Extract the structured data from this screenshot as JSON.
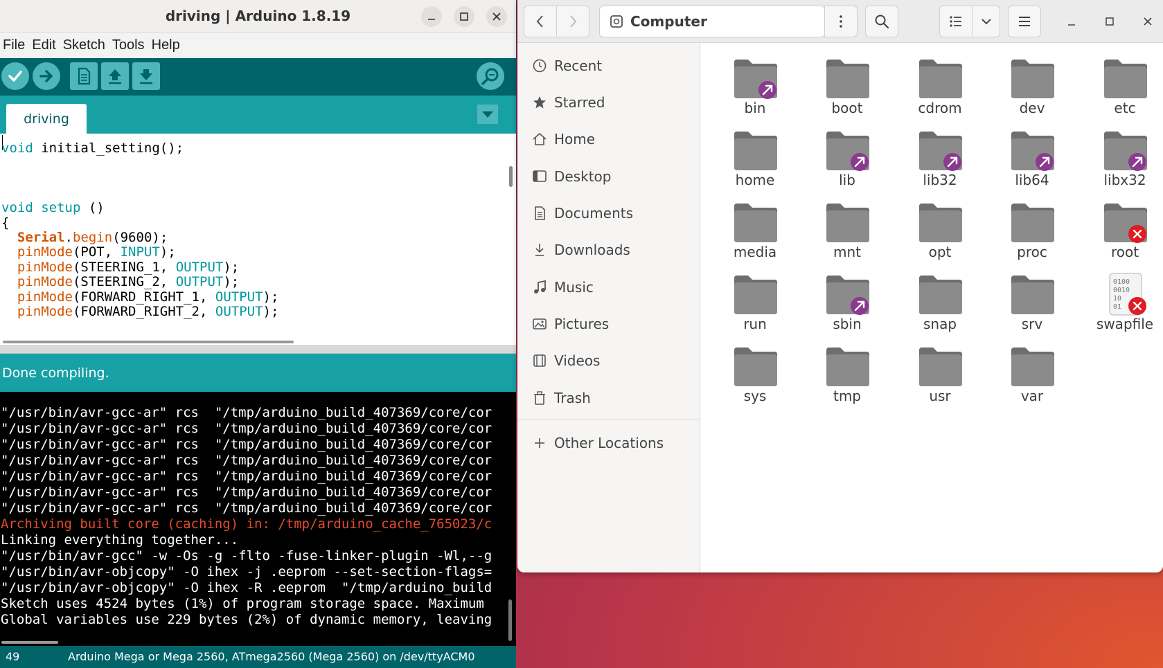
{
  "arduino": {
    "title": "driving | Arduino 1.8.19",
    "menu": [
      "File",
      "Edit",
      "Sketch",
      "Tools",
      "Help"
    ],
    "tab": "driving",
    "code": [
      {
        "parts": [
          {
            "t": "void",
            "c": "kw"
          },
          {
            "t": " initial_setting();",
            "c": ""
          }
        ]
      },
      {
        "parts": [
          {
            "t": "void",
            "c": "kw"
          },
          {
            "t": " ",
            "c": ""
          },
          {
            "t": "setup",
            "c": "kw"
          },
          {
            "t": " ()",
            "c": ""
          }
        ]
      },
      {
        "parts": [
          {
            "t": "{",
            "c": ""
          }
        ]
      },
      {
        "parts": [
          {
            "t": "  ",
            "c": ""
          },
          {
            "t": "Serial",
            "c": "cls"
          },
          {
            "t": ".",
            "c": ""
          },
          {
            "t": "begin",
            "c": "fn"
          },
          {
            "t": "(9600);",
            "c": ""
          }
        ]
      },
      {
        "parts": [
          {
            "t": "  ",
            "c": ""
          },
          {
            "t": "pinMode",
            "c": "fn"
          },
          {
            "t": "(POT, ",
            "c": ""
          },
          {
            "t": "INPUT",
            "c": "cst"
          },
          {
            "t": ");",
            "c": ""
          }
        ]
      },
      {
        "parts": [
          {
            "t": "  ",
            "c": ""
          },
          {
            "t": "pinMode",
            "c": "fn"
          },
          {
            "t": "(STEERING_1, ",
            "c": ""
          },
          {
            "t": "OUTPUT",
            "c": "cst"
          },
          {
            "t": ");",
            "c": ""
          }
        ]
      },
      {
        "parts": [
          {
            "t": "  ",
            "c": ""
          },
          {
            "t": "pinMode",
            "c": "fn"
          },
          {
            "t": "(STEERING_2, ",
            "c": ""
          },
          {
            "t": "OUTPUT",
            "c": "cst"
          },
          {
            "t": ");",
            "c": ""
          }
        ]
      },
      {
        "parts": [
          {
            "t": "  ",
            "c": ""
          },
          {
            "t": "pinMode",
            "c": "fn"
          },
          {
            "t": "(FORWARD_RIGHT_1, ",
            "c": ""
          },
          {
            "t": "OUTPUT",
            "c": "cst"
          },
          {
            "t": ");",
            "c": ""
          }
        ]
      },
      {
        "parts": [
          {
            "t": "  ",
            "c": ""
          },
          {
            "t": "pinMode",
            "c": "fn"
          },
          {
            "t": "(FORWARD_RIGHT_2, ",
            "c": ""
          },
          {
            "t": "OUTPUT",
            "c": "cst"
          },
          {
            "t": ");",
            "c": ""
          }
        ]
      }
    ],
    "status": "Done compiling.",
    "console": [
      {
        "text": "\"/usr/bin/avr-gcc-ar\" rcs  \"/tmp/arduino_build_407369/core/cor",
        "err": false
      },
      {
        "text": "\"/usr/bin/avr-gcc-ar\" rcs  \"/tmp/arduino_build_407369/core/cor",
        "err": false
      },
      {
        "text": "\"/usr/bin/avr-gcc-ar\" rcs  \"/tmp/arduino_build_407369/core/cor",
        "err": false
      },
      {
        "text": "\"/usr/bin/avr-gcc-ar\" rcs  \"/tmp/arduino_build_407369/core/cor",
        "err": false
      },
      {
        "text": "\"/usr/bin/avr-gcc-ar\" rcs  \"/tmp/arduino_build_407369/core/cor",
        "err": false
      },
      {
        "text": "\"/usr/bin/avr-gcc-ar\" rcs  \"/tmp/arduino_build_407369/core/cor",
        "err": false
      },
      {
        "text": "\"/usr/bin/avr-gcc-ar\" rcs  \"/tmp/arduino_build_407369/core/cor",
        "err": false
      },
      {
        "text": "Archiving built core (caching) in: /tmp/arduino_cache_765023/c",
        "err": true
      },
      {
        "text": "Linking everything together...",
        "err": false
      },
      {
        "text": "\"/usr/bin/avr-gcc\" -w -Os -g -flto -fuse-linker-plugin -Wl,--g",
        "err": false
      },
      {
        "text": "\"/usr/bin/avr-objcopy\" -O ihex -j .eeprom --set-section-flags=",
        "err": false
      },
      {
        "text": "\"/usr/bin/avr-objcopy\" -O ihex -R .eeprom  \"/tmp/arduino_build",
        "err": false
      },
      {
        "text": "Sketch uses 4524 bytes (1%) of program storage space. Maximum ",
        "err": false
      },
      {
        "text": "Global variables use 229 bytes (2%) of dynamic memory, leaving",
        "err": false
      }
    ],
    "footer": {
      "line": "49",
      "board": "Arduino Mega or Mega 2560, ATmega2560 (Mega 2560) on /dev/ttyACM0"
    },
    "colors": {
      "toolbar": "#006468",
      "tabbar": "#17a1a5",
      "error": "#e34c26"
    }
  },
  "files": {
    "location": "Computer",
    "sidebar": [
      {
        "label": "Recent",
        "icon": "clock-icon"
      },
      {
        "label": "Starred",
        "icon": "star-icon"
      },
      {
        "label": "Home",
        "icon": "home-icon"
      },
      {
        "label": "Desktop",
        "icon": "desktop-icon"
      },
      {
        "label": "Documents",
        "icon": "document-icon"
      },
      {
        "label": "Downloads",
        "icon": "download-icon"
      },
      {
        "label": "Music",
        "icon": "music-icon"
      },
      {
        "label": "Pictures",
        "icon": "picture-icon"
      },
      {
        "label": "Videos",
        "icon": "video-icon"
      },
      {
        "label": "Trash",
        "icon": "trash-icon"
      },
      {
        "label": "Other Locations",
        "icon": "plus-icon"
      }
    ],
    "items": [
      {
        "name": "bin",
        "badge": "link"
      },
      {
        "name": "boot",
        "badge": "none"
      },
      {
        "name": "cdrom",
        "badge": "none"
      },
      {
        "name": "dev",
        "badge": "none"
      },
      {
        "name": "etc",
        "badge": "none"
      },
      {
        "name": "home",
        "badge": "none"
      },
      {
        "name": "lib",
        "badge": "link"
      },
      {
        "name": "lib32",
        "badge": "link"
      },
      {
        "name": "lib64",
        "badge": "link"
      },
      {
        "name": "libx32",
        "badge": "link"
      },
      {
        "name": "media",
        "badge": "none"
      },
      {
        "name": "mnt",
        "badge": "none"
      },
      {
        "name": "opt",
        "badge": "none"
      },
      {
        "name": "proc",
        "badge": "none"
      },
      {
        "name": "root",
        "badge": "locked"
      },
      {
        "name": "run",
        "badge": "none"
      },
      {
        "name": "sbin",
        "badge": "link"
      },
      {
        "name": "snap",
        "badge": "none"
      },
      {
        "name": "srv",
        "badge": "none"
      },
      {
        "name": "swapfile",
        "badge": "locked",
        "type": "file",
        "file_text": [
          "0100",
          "0010",
          "10",
          "01"
        ]
      },
      {
        "name": "sys",
        "badge": "none"
      },
      {
        "name": "tmp",
        "badge": "none"
      },
      {
        "name": "usr",
        "badge": "none"
      },
      {
        "name": "var",
        "badge": "none"
      }
    ],
    "colors": {
      "folder": "#8b8b8b",
      "link_badge": "#8a3a8f",
      "locked_badge": "#e01b24"
    }
  }
}
